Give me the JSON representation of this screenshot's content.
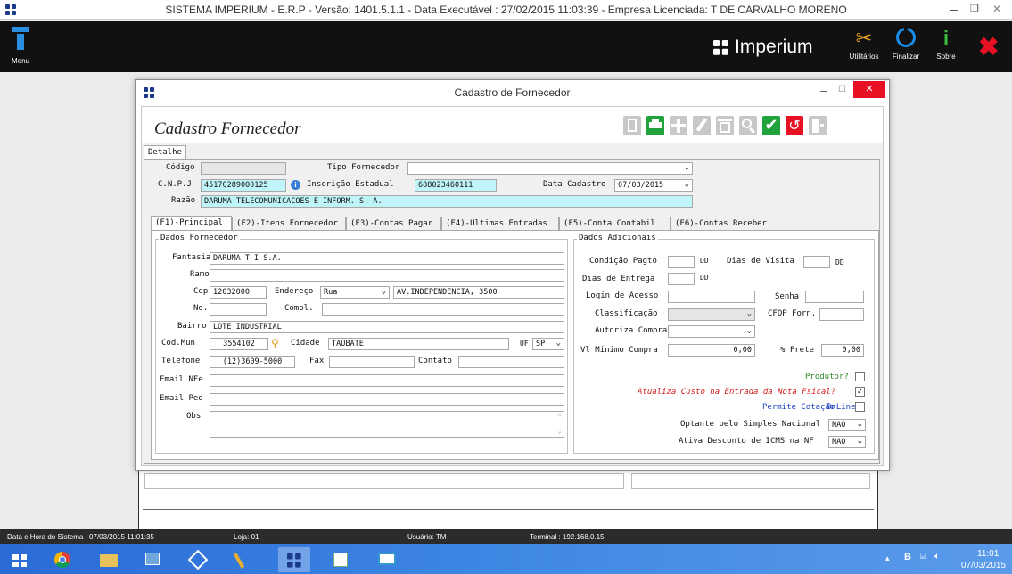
{
  "window": {
    "title": "SISTEMA IMPERIUM - E.R.P - Versão: 1401.5.1.1 - Data Executável : 27/02/2015 11:03:39 - Empresa Licenciada: T DE CARVALHO MORENO"
  },
  "topbar": {
    "menu_label": "Menu",
    "brand": "Imperium",
    "utilitarios_label": "Utilitários",
    "finalizar_label": "Finalizar",
    "sobre_label": "Sobre"
  },
  "dialog": {
    "title": "Cadastro de Fornecedor",
    "heading": "Cadastro Fornecedor",
    "top_tab": "Detalhe"
  },
  "header_fields": {
    "codigo_label": "Código",
    "codigo_value": "",
    "tipo_label": "Tipo Fornecedor",
    "tipo_value": "",
    "cnpj_label": "C.N.P.J",
    "cnpj_value": "45170289000125",
    "ie_label": "Inscrição Estadual",
    "ie_value": "688023460111",
    "data_cadastro_label": "Data Cadastro",
    "data_cadastro_value": "07/03/2015",
    "razao_label": "Razão",
    "razao_value": "DARUMA TELECOMUNICACOES E INFORM. S. A."
  },
  "tabs": [
    "(F1)-Principal",
    "(F2)-Itens Fornecedor",
    "(F3)-Contas Pagar",
    "(F4)-Ultimas Entradas",
    "(F5)-Conta Contabil",
    "(F6)-Contas Receber"
  ],
  "dados_fornecedor": {
    "title": "Dados Fornecedor",
    "fantasia_label": "Fantasia",
    "fantasia_value": "DARUMA T I S.A.",
    "ramo_label": "Ramo",
    "ramo_value": "",
    "cep_label": "Cep",
    "cep_value": "12032000",
    "endereco_label": "Endereço",
    "endereco_tipo": "Rua",
    "endereco_value": "AV.INDEPENDENCIA,  3500",
    "no_label": "No.",
    "no_value": "",
    "compl_label": "Compl.",
    "compl_value": "",
    "bairro_label": "Bairro",
    "bairro_value": "LOTE INDUSTRIAL",
    "codmun_label": "Cod.Mun",
    "codmun_value": "3554102",
    "cidade_label": "Cidade",
    "cidade_value": "TAUBATE",
    "uf_label": "UF",
    "uf_value": "SP",
    "telefone_label": "Telefone",
    "telefone_value": "(12)3609-5000",
    "fax_label": "Fax",
    "fax_value": "",
    "contato_label": "Contato",
    "contato_value": "",
    "email_nfe_label": "Email NFe",
    "email_ped_label": "Email Ped",
    "obs_label": "Obs"
  },
  "dados_adicionais": {
    "title": "Dados Adicionais",
    "condicao_label": "Condição Pagto",
    "dd1": "DD",
    "dias_visita_label": "Dias de Visita",
    "dd2": "DD",
    "dias_entrega_label": "Dias de Entrega",
    "dd3": "DD",
    "login_label": "Login de Acesso",
    "senha_label": "Senha",
    "classificacao_label": "Classificação",
    "cfop_label": "CFOP Forn.",
    "autoriza_label": "Autoriza Compra",
    "vl_minimo_label": "Vl Mínimo Compra",
    "vl_minimo_value": "0,00",
    "frete_label": "% Frete",
    "frete_value": "0,00",
    "produtor_label": "Produtor?",
    "atualiza_label": "Atualiza Custo na Entrada da Nota Fsical?",
    "permite_label": "Permite Cotação",
    "online_label": "OnLine",
    "simples_label": "Optante pelo Simples Nacional",
    "simples_value": "NAO",
    "icms_label": "Ativa Desconto de ICMS na NF",
    "icms_value": "NAO"
  },
  "statusbar": {
    "datahora": "Data e Hora do Sistema :  07/03/2015 11:01:35",
    "loja": "Loja:  01",
    "usuario": "Usuário:  TM",
    "terminal": "Terminal :  192.168.0.15"
  },
  "taskbar": {
    "time": "11:01",
    "date": "07/03/2015"
  },
  "colors": {
    "input_highlight": "#bff4f8",
    "close_red": "#e81123",
    "accent_blue": "#1a6fd8",
    "confirm_green": "#1fa33a"
  }
}
